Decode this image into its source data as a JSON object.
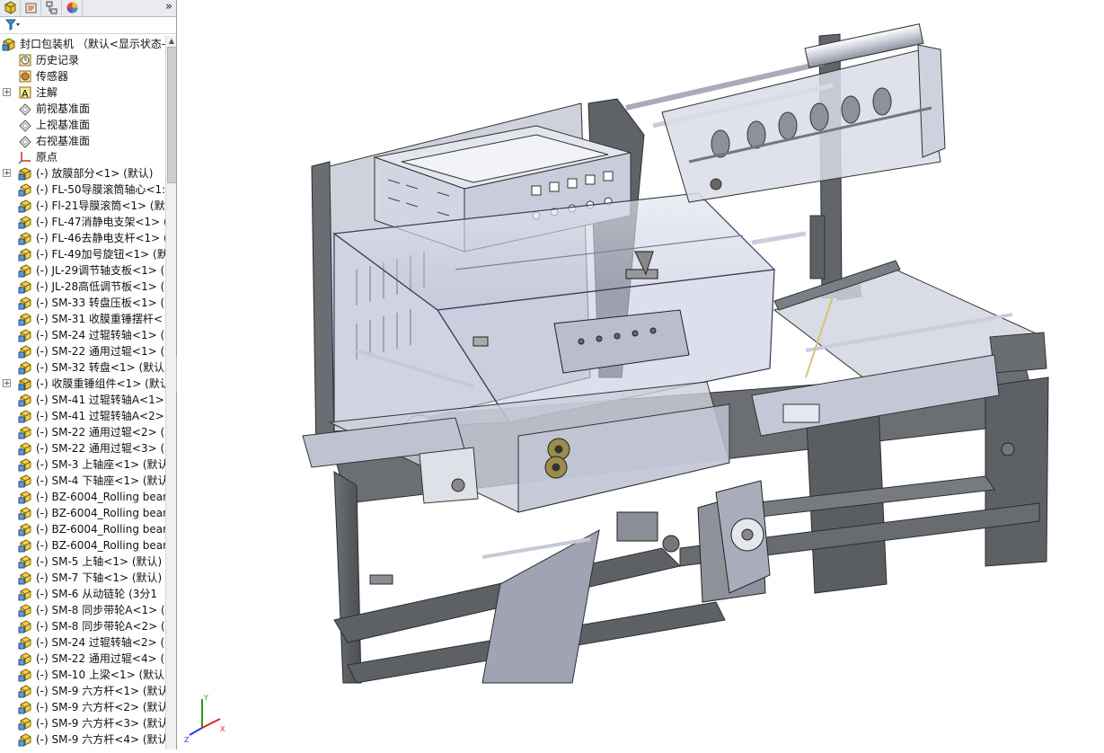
{
  "toolbar": {
    "buttons": [
      "feature-manager-icon",
      "property-manager-icon",
      "configuration-manager-icon",
      "display-manager-icon"
    ],
    "expand_glyph": "»"
  },
  "filter": {
    "icon": "filter-icon",
    "arrow": "▾"
  },
  "tree": {
    "root": "封口包装机 （默认<显示状态-",
    "items": [
      {
        "label": "历史记录",
        "icon": "history-icon",
        "expandable": false
      },
      {
        "label": "传感器",
        "icon": "sensor-icon",
        "expandable": false
      },
      {
        "label": "注解",
        "icon": "annotation-icon",
        "expandable": true
      },
      {
        "label": "前视基准面",
        "icon": "plane-icon",
        "expandable": false
      },
      {
        "label": "上视基准面",
        "icon": "plane-icon",
        "expandable": false
      },
      {
        "label": "右视基准面",
        "icon": "plane-icon",
        "expandable": false
      },
      {
        "label": "原点",
        "icon": "origin-icon",
        "expandable": false
      },
      {
        "label": "(-) 放膜部分<1> (默认)",
        "icon": "subassembly-icon",
        "expandable": true
      },
      {
        "label": "(-) FL-50导膜滚筒轴心<1:",
        "icon": "part-icon",
        "expandable": false
      },
      {
        "label": "(-) Fl-21导膜滚筒<1> (默认",
        "icon": "part-icon",
        "expandable": false
      },
      {
        "label": "(-) FL-47消静电支架<1> (",
        "icon": "part-icon",
        "expandable": false
      },
      {
        "label": "(-) FL-46去静电支杆<1> (",
        "icon": "part-icon",
        "expandable": false
      },
      {
        "label": "(-) FL-49加号旋钮<1> (默",
        "icon": "part-icon",
        "expandable": false
      },
      {
        "label": "(-) JL-29调节轴支板<1> (",
        "icon": "part-icon",
        "expandable": false
      },
      {
        "label": "(-) JL-28高低调节板<1> (",
        "icon": "part-icon",
        "expandable": false
      },
      {
        "label": "(-) SM-33 转盘压板<1> (",
        "icon": "part-icon",
        "expandable": false
      },
      {
        "label": "(-) SM-31 收膜重锤摆杆<",
        "icon": "part-icon",
        "expandable": false
      },
      {
        "label": "(-) SM-24 过辊转轴<1> (",
        "icon": "part-icon",
        "expandable": false
      },
      {
        "label": "(-) SM-22 通用过辊<1> (",
        "icon": "part-icon",
        "expandable": false
      },
      {
        "label": "(-) SM-32 转盘<1> (默认",
        "icon": "part-icon",
        "expandable": false
      },
      {
        "label": "(-) 收膜重锤组件<1> (默认",
        "icon": "subassembly-icon",
        "expandable": true
      },
      {
        "label": "(-) SM-41 过辊转轴A<1>",
        "icon": "part-icon",
        "expandable": false
      },
      {
        "label": "(-) SM-41 过辊转轴A<2>",
        "icon": "part-icon",
        "expandable": false
      },
      {
        "label": "(-) SM-22 通用过辊<2> (",
        "icon": "part-icon",
        "expandable": false
      },
      {
        "label": "(-) SM-22 通用过辊<3> (",
        "icon": "part-icon",
        "expandable": false
      },
      {
        "label": "(-) SM-3 上轴座<1> (默认",
        "icon": "part-icon",
        "expandable": false
      },
      {
        "label": "(-) SM-4 下轴座<1> (默认",
        "icon": "part-icon",
        "expandable": false
      },
      {
        "label": "(-) BZ-6004_Rolling bear",
        "icon": "part-icon",
        "expandable": false
      },
      {
        "label": "(-) BZ-6004_Rolling bear",
        "icon": "part-icon",
        "expandable": false
      },
      {
        "label": "(-) BZ-6004_Rolling bear",
        "icon": "part-icon",
        "expandable": false
      },
      {
        "label": "(-) BZ-6004_Rolling bear",
        "icon": "part-icon",
        "expandable": false
      },
      {
        "label": "(-) SM-5 上轴<1> (默认)",
        "icon": "part-icon",
        "expandable": false
      },
      {
        "label": "(-) SM-7 下轴<1> (默认)",
        "icon": "part-icon",
        "expandable": false
      },
      {
        "label": "(-) SM-6 从动链轮 (3分1",
        "icon": "part-icon",
        "expandable": false
      },
      {
        "label": "(-) SM-8 同步带轮A<1> (",
        "icon": "part-icon",
        "expandable": false
      },
      {
        "label": "(-) SM-8 同步带轮A<2> (",
        "icon": "part-icon",
        "expandable": false
      },
      {
        "label": "(-) SM-24 过辊转轴<2> (",
        "icon": "part-icon",
        "expandable": false
      },
      {
        "label": "(-) SM-22 通用过辊<4> (",
        "icon": "part-icon",
        "expandable": false
      },
      {
        "label": "(-) SM-10 上梁<1> (默认",
        "icon": "part-icon",
        "expandable": false
      },
      {
        "label": "(-) SM-9 六方杆<1> (默认",
        "icon": "part-icon",
        "expandable": false
      },
      {
        "label": "(-) SM-9 六方杆<2> (默认",
        "icon": "part-icon",
        "expandable": false
      },
      {
        "label": "(-) SM-9 六方杆<3> (默认",
        "icon": "part-icon",
        "expandable": false
      },
      {
        "label": "(-) SM-9 六方杆<4> (默认",
        "icon": "part-icon",
        "expandable": false
      }
    ]
  },
  "triad": {
    "x_label": "X",
    "y_label": "Y",
    "z_label": "Z",
    "x_color": "#e02020",
    "y_color": "#20a020",
    "z_color": "#2040e0"
  },
  "colors": {
    "frame": "#5d6166",
    "frame_dark": "#3e4145",
    "housing": "#d8dbe8",
    "glass": "#c9cde0",
    "panel_bg": "#ffffff"
  }
}
